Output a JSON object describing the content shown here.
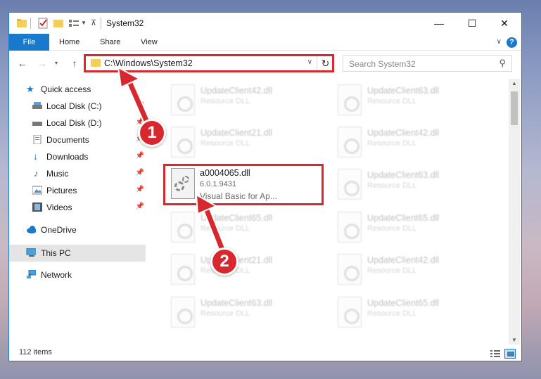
{
  "window": {
    "title": "System32",
    "controls": {
      "minimize": "—",
      "maximize": "☐",
      "close": "✕"
    }
  },
  "ribbon": {
    "tabs": [
      "File",
      "Home",
      "Share",
      "View"
    ],
    "help": "?"
  },
  "address": {
    "path": "C:\\Windows\\System32",
    "search_placeholder": "Search System32"
  },
  "sidebar": {
    "items": [
      {
        "label": "Quick access",
        "icon": "star-icon",
        "pinned": false
      },
      {
        "label": "Local Disk (C:)",
        "icon": "drive-icon",
        "pinned": true
      },
      {
        "label": "Local Disk (D:)",
        "icon": "drive-icon",
        "pinned": true
      },
      {
        "label": "Documents",
        "icon": "documents-icon",
        "pinned": true
      },
      {
        "label": "Downloads",
        "icon": "download-icon",
        "pinned": true
      },
      {
        "label": "Music",
        "icon": "music-icon",
        "pinned": true
      },
      {
        "label": "Pictures",
        "icon": "pictures-icon",
        "pinned": true
      },
      {
        "label": "Videos",
        "icon": "videos-icon",
        "pinned": true
      },
      {
        "label": "OneDrive",
        "icon": "cloud-icon",
        "pinned": false
      },
      {
        "label": "This PC",
        "icon": "computer-icon",
        "pinned": false,
        "selected": true
      },
      {
        "label": "Network",
        "icon": "network-icon",
        "pinned": false
      }
    ]
  },
  "files": {
    "background": [
      {
        "name": "UpdateClient42.dll",
        "desc": "Resource DLL"
      },
      {
        "name": "UpdateClient63.dll",
        "desc": "Resource DLL"
      },
      {
        "name": "UpdateClient21.dll",
        "desc": "Resource DLL"
      },
      {
        "name": "UpdateClient42.dll",
        "desc": "Resource DLL"
      },
      {
        "name": "UpdateClient63.dll",
        "desc": "Resource DLL"
      },
      {
        "name": "UpdateClient65.dll",
        "desc": "Resource DLL"
      },
      {
        "name": "UpdateClient65.dll",
        "desc": "Resource DLL"
      },
      {
        "name": "UpdateClient21.dll",
        "desc": "Resource DLL"
      },
      {
        "name": "UpdateClient42.dll",
        "desc": "Resource DLL"
      },
      {
        "name": "UpdateClient63.dll",
        "desc": "Resource DLL"
      },
      {
        "name": "UpdateClient65.dll",
        "desc": "Resource DLL"
      }
    ],
    "highlighted": {
      "name": "a0004065.dll",
      "version": "6.0.1.9431",
      "desc": "Visual Basic for Ap..."
    }
  },
  "status": {
    "items": "112 items"
  },
  "callouts": [
    "1",
    "2"
  ],
  "colors": {
    "accent": "#1979ca",
    "highlight": "#d8282f"
  }
}
